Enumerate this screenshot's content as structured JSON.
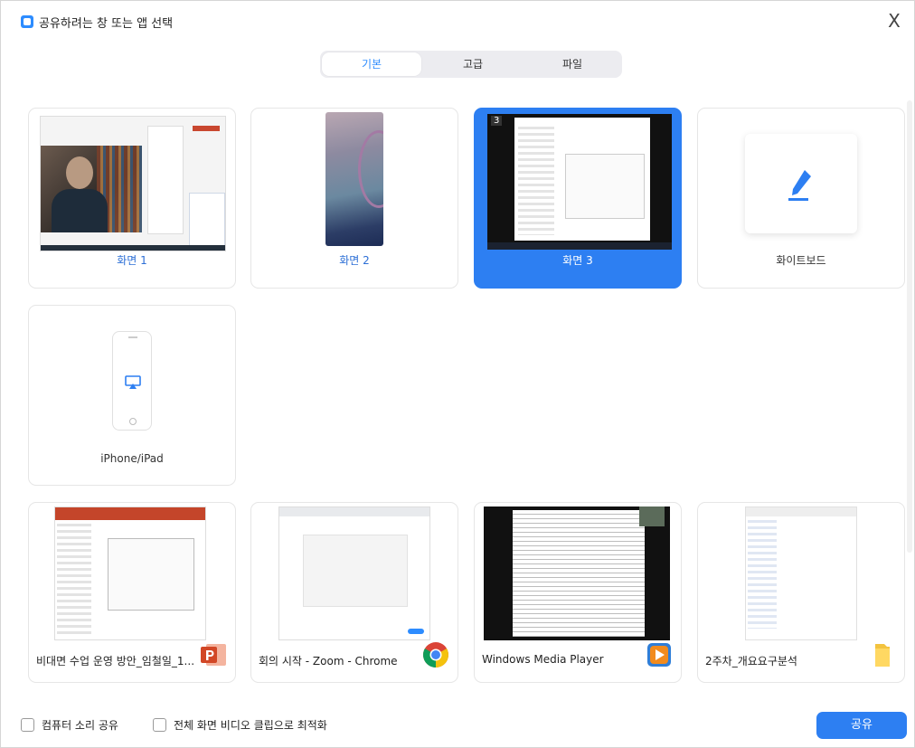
{
  "window": {
    "title": "공유하려는 창 또는 앱 선택",
    "close_glyph": "X"
  },
  "tabs": [
    {
      "label": "기본",
      "active": true
    },
    {
      "label": "고급",
      "active": false
    },
    {
      "label": "파일",
      "active": false
    }
  ],
  "screens": [
    {
      "label": "화면 1"
    },
    {
      "label": "화면 2"
    },
    {
      "label": "화면 3",
      "number": "3",
      "selected": true
    },
    {
      "label": "화이트보드"
    }
  ],
  "devices": [
    {
      "label": "iPhone/iPad"
    }
  ],
  "apps": [
    {
      "label": "비대면 수업 운영 방안_임철일_1...",
      "icon": "powerpoint-icon"
    },
    {
      "label": "회의 시작 - Zoom - Chrome",
      "icon": "chrome-icon"
    },
    {
      "label": "Windows Media Player",
      "icon": "windows-media-player-icon"
    },
    {
      "label": "2주차_개요요구분석",
      "icon": "folder-icon"
    }
  ],
  "footer": {
    "share_sound": "컴퓨터 소리 공유",
    "optimize_video": "전체 화면 비디오 클립으로 최적화",
    "share_button": "공유"
  },
  "colors": {
    "accent": "#2d7ff2",
    "selected_tile": "#2d7ff2"
  }
}
